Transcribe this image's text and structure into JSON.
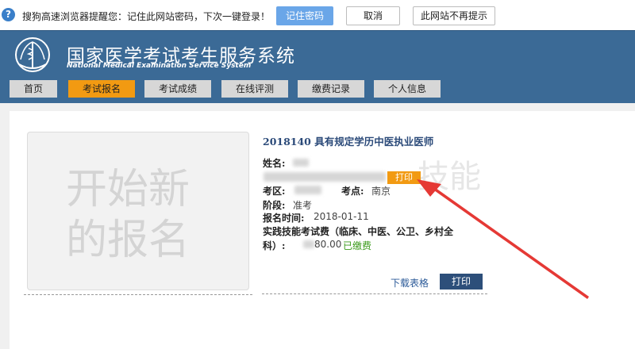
{
  "password_bar": {
    "message": "搜狗高速浏览器提醒您：记住此网站密码，下次一键登录！",
    "save_label": "记住密码",
    "cancel_label": "取消",
    "never_label": "此网站不再提示"
  },
  "header": {
    "title_cn": "国家医学考试考生服务系统",
    "title_en": "National Medical Examination Service System"
  },
  "nav": {
    "items": [
      {
        "label": "首页"
      },
      {
        "label": "考试报名"
      },
      {
        "label": "考试成绩"
      },
      {
        "label": "在线评测"
      },
      {
        "label": "缴费记录"
      },
      {
        "label": "个人信息"
      }
    ],
    "active_index": 1
  },
  "card": {
    "thumb_text_line1": "开始新",
    "thumb_text_line2": "的报名",
    "exam_title": "2018140 具有规定学历中医执业医师",
    "name_label": "姓名:",
    "print_badge": "打印",
    "watermark": "技能",
    "district_label": "考区:",
    "site_label": "考点:",
    "site_value": "南京",
    "stage_label": "阶段:",
    "stage_value": "准考",
    "time_label": "报名时间:",
    "time_value": "2018-01-11",
    "fee_label_line1": "实践技能考试费（临床、中医、公卫、乡村全",
    "fee_label_line2": "科）:",
    "fee_value": "80.00",
    "paid_status": "已缴费",
    "download_link": "下载表格",
    "print_button": "打印"
  },
  "colors": {
    "header_bg": "#3b6a96",
    "nav_active": "#f29a12",
    "annotation_arrow": "#e53935"
  }
}
